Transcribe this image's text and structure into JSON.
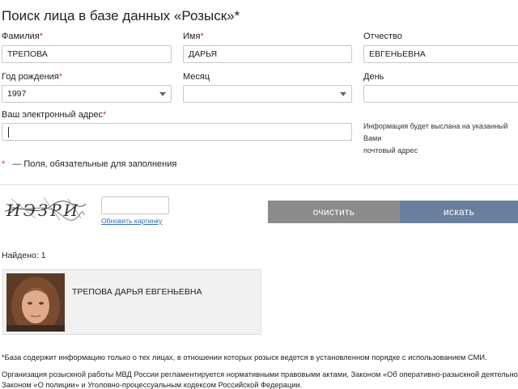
{
  "page": {
    "title": "Поиск лица в базе данных «Розыск»",
    "title_required_mark": "*"
  },
  "form": {
    "surname": {
      "label": "Фамилия",
      "required_mark": "*",
      "value": "ТРЕПОВА"
    },
    "name": {
      "label": "Имя",
      "required_mark": "*",
      "value": "ДАРЬЯ"
    },
    "patronymic": {
      "label": "Отчество",
      "value": "ЕВГЕНЬЕВНА"
    },
    "birth_year": {
      "label": "Год рождения",
      "required_mark": "*",
      "value": "1997"
    },
    "month": {
      "label": "Месяц",
      "value": ""
    },
    "day": {
      "label": "День",
      "value": ""
    },
    "email": {
      "label": "Ваш электронный адрес",
      "required_mark": "*",
      "value": "",
      "hint_line1": "Информация будет выслана на указанный Вами",
      "hint_line2": "почтовый адрес"
    },
    "required_note_mark": "*",
    "required_note": "— Поля, обязательные для заполнения"
  },
  "captcha": {
    "image_text": "ИЭЗРИ",
    "input_value": "",
    "refresh_link": "Обновить картинку"
  },
  "buttons": {
    "clear": "очистить",
    "search": "искать"
  },
  "results": {
    "found_label": "Найдено: 1",
    "items": [
      {
        "full_name": "ТРЕПОВА ДАРЬЯ ЕВГЕНЬЕВНА"
      }
    ]
  },
  "footer": {
    "disclaimer": "*База содержит информацию только о тех лицах, в отношении которых розыск ведется в установленном порядке с использованием СМИ.",
    "law_line1": "Организация розыскной работы МВД России регламентируется нормативными правовыми актами, Законом «Об оперативно-разыскной деятельности»,",
    "law_line2": "Законом «О полиции» и Уголовно-процессуальным кодексом Российской Федерации."
  },
  "colors": {
    "required": "#c0392b",
    "button_clear": "#8b8b8b",
    "button_search": "#6a7f9e",
    "link": "#2f6db5",
    "result_card": "#f1f1f1"
  }
}
